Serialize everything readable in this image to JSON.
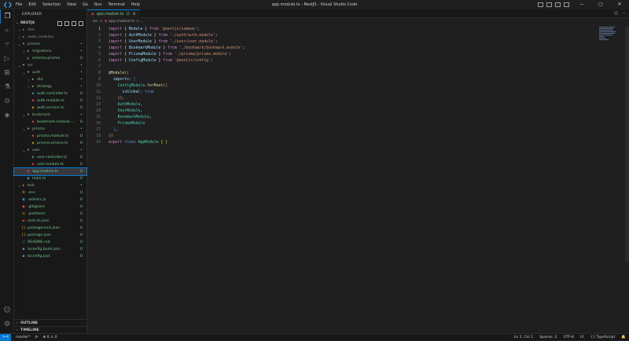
{
  "titlebar": {
    "menu": [
      "File",
      "Edit",
      "Selection",
      "View",
      "Go",
      "Run",
      "Terminal",
      "Help"
    ],
    "title": "app.module.ts - NestJS - Visual Studio Code",
    "controls": [
      "—",
      "▢",
      "✕"
    ]
  },
  "activity": {
    "icons": [
      "files-icon",
      "search-icon",
      "source-control-icon",
      "run-debug-icon",
      "extensions-icon",
      "testing-icon",
      "remote-explorer-icon",
      "docker-icon"
    ],
    "bottom": [
      "account-icon",
      "gear-icon"
    ]
  },
  "sidebar": {
    "title": "EXPLORER",
    "project": "NESTJS",
    "tree": [
      {
        "name": "dist",
        "type": "folder",
        "depth": 0,
        "open": false,
        "badge": "",
        "color": "grey"
      },
      {
        "name": "node_modules",
        "type": "folder",
        "depth": 0,
        "open": false,
        "badge": "",
        "color": "grey"
      },
      {
        "name": "prisma",
        "type": "folder",
        "depth": 0,
        "open": true,
        "badge": "•",
        "color": "green"
      },
      {
        "name": "migrations",
        "type": "folder",
        "depth": 1,
        "open": false,
        "badge": "•",
        "color": "green"
      },
      {
        "name": "schema.prisma",
        "type": "prisma",
        "depth": 1,
        "open": false,
        "badge": "U",
        "color": "green"
      },
      {
        "name": "src",
        "type": "folder",
        "depth": 0,
        "open": true,
        "badge": "•",
        "color": "green"
      },
      {
        "name": "auth",
        "type": "folder",
        "depth": 1,
        "open": true,
        "badge": "•",
        "color": "green"
      },
      {
        "name": "dto",
        "type": "folder",
        "depth": 2,
        "open": false,
        "badge": "•",
        "color": "green"
      },
      {
        "name": "strategy",
        "type": "folder",
        "depth": 2,
        "open": false,
        "badge": "•",
        "color": "green"
      },
      {
        "name": "auth.controller.ts",
        "type": "controller",
        "depth": 2,
        "open": false,
        "badge": "U",
        "color": "green"
      },
      {
        "name": "auth.module.ts",
        "type": "module",
        "depth": 2,
        "open": false,
        "badge": "U",
        "color": "green"
      },
      {
        "name": "auth.service.ts",
        "type": "service",
        "depth": 2,
        "open": false,
        "badge": "U",
        "color": "green"
      },
      {
        "name": "bookmark",
        "type": "folder",
        "depth": 1,
        "open": true,
        "badge": "•",
        "color": "green"
      },
      {
        "name": "bookmark.module....",
        "type": "module",
        "depth": 2,
        "open": false,
        "badge": "U",
        "color": "green"
      },
      {
        "name": "prisma",
        "type": "folder",
        "depth": 1,
        "open": true,
        "badge": "•",
        "color": "green"
      },
      {
        "name": "prisma.module.ts",
        "type": "module",
        "depth": 2,
        "open": false,
        "badge": "U",
        "color": "green"
      },
      {
        "name": "prisma.service.ts",
        "type": "service",
        "depth": 2,
        "open": false,
        "badge": "U",
        "color": "green"
      },
      {
        "name": "user",
        "type": "folder",
        "depth": 1,
        "open": true,
        "badge": "•",
        "color": "green"
      },
      {
        "name": "user.controller.ts",
        "type": "controller",
        "depth": 2,
        "open": false,
        "badge": "U",
        "color": "green"
      },
      {
        "name": "user.module.ts",
        "type": "module",
        "depth": 2,
        "open": false,
        "badge": "U",
        "color": "green"
      },
      {
        "name": "app.module.ts",
        "type": "module",
        "depth": 1,
        "open": false,
        "badge": "U",
        "color": "green",
        "selected": true
      },
      {
        "name": "main.ts",
        "type": "ts",
        "depth": 1,
        "open": false,
        "badge": "U",
        "color": "green"
      },
      {
        "name": "test",
        "type": "folder",
        "depth": 0,
        "open": false,
        "badge": "•",
        "color": "green"
      },
      {
        "name": ".env",
        "type": "env",
        "depth": 0,
        "open": false,
        "badge": "U",
        "color": "green"
      },
      {
        "name": ".eslintrc.js",
        "type": "eslint",
        "depth": 0,
        "open": false,
        "badge": "U",
        "color": "green"
      },
      {
        "name": ".gitignore",
        "type": "git",
        "depth": 0,
        "open": false,
        "badge": "U",
        "color": "green"
      },
      {
        "name": ".prettierrc",
        "type": "prettier",
        "depth": 0,
        "open": false,
        "badge": "U",
        "color": "green"
      },
      {
        "name": "nest-cli.json",
        "type": "nest",
        "depth": 0,
        "open": false,
        "badge": "U",
        "color": "green"
      },
      {
        "name": "package-lock.json",
        "type": "json",
        "depth": 0,
        "open": false,
        "badge": "U",
        "color": "green"
      },
      {
        "name": "package.json",
        "type": "json",
        "depth": 0,
        "open": false,
        "badge": "U",
        "color": "green"
      },
      {
        "name": "README.md",
        "type": "md",
        "depth": 0,
        "open": false,
        "badge": "U",
        "color": "green"
      },
      {
        "name": "tsconfig.build.json",
        "type": "tsconfig",
        "depth": 0,
        "open": false,
        "badge": "U",
        "color": "green"
      },
      {
        "name": "tsconfig.json",
        "type": "tsconfig",
        "depth": 0,
        "open": false,
        "badge": "U",
        "color": "green"
      }
    ],
    "sections": [
      "OUTLINE",
      "TIMELINE"
    ]
  },
  "editor": {
    "tab": {
      "label": "app.module.ts",
      "badge": "U",
      "close": "✕"
    },
    "breadcrumb": {
      "folder": "src",
      "sep": ">",
      "file": "app.module.ts",
      "more": "> ..."
    },
    "lines": [
      [
        [
          "kw",
          "import"
        ],
        [
          "pun",
          " { "
        ],
        [
          "var",
          "Module"
        ],
        [
          "pun",
          " } "
        ],
        [
          "kw",
          "from"
        ],
        [
          "pun",
          " "
        ],
        [
          "str",
          "'@nestjs/common'"
        ],
        [
          "pun",
          ";"
        ]
      ],
      [
        [
          "kw",
          "import"
        ],
        [
          "pun",
          " { "
        ],
        [
          "var",
          "AuthModule"
        ],
        [
          "pun",
          " } "
        ],
        [
          "kw",
          "from"
        ],
        [
          "pun",
          " "
        ],
        [
          "str",
          "'./auth/auth.module'"
        ],
        [
          "pun",
          ";"
        ]
      ],
      [
        [
          "kw",
          "import"
        ],
        [
          "pun",
          " { "
        ],
        [
          "var",
          "UserModule"
        ],
        [
          "pun",
          " } "
        ],
        [
          "kw",
          "from"
        ],
        [
          "pun",
          " "
        ],
        [
          "str",
          "'./user/user.module'"
        ],
        [
          "pun",
          ";"
        ]
      ],
      [
        [
          "kw",
          "import"
        ],
        [
          "pun",
          " { "
        ],
        [
          "var",
          "BookmarkModule"
        ],
        [
          "pun",
          " } "
        ],
        [
          "kw",
          "from"
        ],
        [
          "pun",
          " "
        ],
        [
          "str",
          "'./bookmark/bookmark.module'"
        ],
        [
          "pun",
          ";"
        ]
      ],
      [
        [
          "kw",
          "import"
        ],
        [
          "pun",
          " { "
        ],
        [
          "var",
          "PrismaModule"
        ],
        [
          "pun",
          " } "
        ],
        [
          "kw",
          "from"
        ],
        [
          "pun",
          " "
        ],
        [
          "str",
          "'./prisma/prisma.module'"
        ],
        [
          "pun",
          ";"
        ]
      ],
      [
        [
          "kw",
          "import"
        ],
        [
          "pun",
          " { "
        ],
        [
          "var",
          "ConfigModule"
        ],
        [
          "pun",
          " } "
        ],
        [
          "kw",
          "from"
        ],
        [
          "pun",
          " "
        ],
        [
          "str",
          "'@nestjs/config'"
        ],
        [
          "pun",
          ";"
        ]
      ],
      [],
      [
        [
          "fn",
          "@Module"
        ],
        [
          "br",
          "("
        ],
        [
          "br2",
          "{"
        ]
      ],
      [
        [
          "pun",
          "  "
        ],
        [
          "var",
          "imports"
        ],
        [
          "pun",
          ": "
        ],
        [
          "br3",
          "["
        ]
      ],
      [
        [
          "pun",
          "    "
        ],
        [
          "cls",
          "ConfigModule"
        ],
        [
          "pun",
          "."
        ],
        [
          "fn",
          "forRoot"
        ],
        [
          "br",
          "("
        ],
        [
          "br2",
          "{"
        ]
      ],
      [
        [
          "pun",
          "      "
        ],
        [
          "var",
          "isGlobal"
        ],
        [
          "pun",
          ": "
        ],
        [
          "bl",
          "true"
        ]
      ],
      [
        [
          "pun",
          "    "
        ],
        [
          "br2",
          "}"
        ],
        [
          "br",
          ")"
        ],
        [
          "pun",
          ","
        ]
      ],
      [
        [
          "pun",
          "    "
        ],
        [
          "cls",
          "AuthModule"
        ],
        [
          "pun",
          ","
        ]
      ],
      [
        [
          "pun",
          "    "
        ],
        [
          "cls",
          "UserModule"
        ],
        [
          "pun",
          ","
        ]
      ],
      [
        [
          "pun",
          "    "
        ],
        [
          "cls",
          "BookmarkModule"
        ],
        [
          "pun",
          ","
        ]
      ],
      [
        [
          "pun",
          "    "
        ],
        [
          "cls",
          "PrismaModule"
        ]
      ],
      [
        [
          "pun",
          "  "
        ],
        [
          "br3",
          "]"
        ],
        [
          "pun",
          ","
        ]
      ],
      [
        [
          "br2",
          "}"
        ],
        [
          "br",
          ")"
        ]
      ],
      [
        [
          "kw",
          "export"
        ],
        [
          "pun",
          " "
        ],
        [
          "bl",
          "class"
        ],
        [
          "pun",
          " "
        ],
        [
          "cls",
          "AppModule"
        ],
        [
          "pun",
          " "
        ],
        [
          "br",
          "{"
        ],
        [
          "pun",
          " "
        ],
        [
          "br",
          "}"
        ]
      ]
    ],
    "current_line": 1
  },
  "statusbar": {
    "remote": "><",
    "branch": "master*",
    "sync": "⟳",
    "problems": "⊗ 0 ⚠ 0",
    "right": [
      "Ln 1, Col 1",
      "Spaces: 2",
      "UTF-8",
      "LF",
      "{} TypeScript",
      "🔔"
    ]
  }
}
